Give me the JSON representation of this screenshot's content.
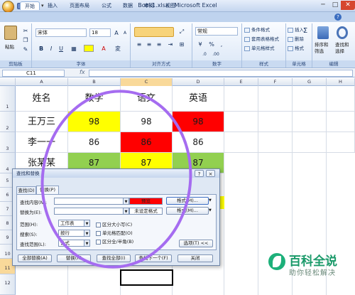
{
  "window": {
    "title": "Book1.xlsx - Microsoft Excel"
  },
  "tabs": [
    "开始",
    "插入",
    "页面布局",
    "公式",
    "数据",
    "审阅",
    "视图"
  ],
  "ribbon": {
    "clipboard": {
      "paste": "粘贴",
      "label": "剪贴板"
    },
    "font": {
      "name": "宋体",
      "size": "18",
      "bold": "B",
      "italic": "I",
      "underline": "U",
      "label": "字体"
    },
    "alignment": {
      "label": "对齐方式"
    },
    "number": {
      "format": "常规",
      "percent": "%",
      "comma": ",",
      "label": "数字"
    },
    "styles": {
      "items": [
        "条件格式",
        "套用表格格式",
        "单元格样式"
      ],
      "label": "样式"
    },
    "cells": {
      "items": [
        "插入",
        "删除",
        "格式"
      ],
      "label": "单元格"
    },
    "editing": {
      "sort": "排序和",
      "sort2": "筛选",
      "find": "查找和",
      "find2": "选择",
      "label": "编辑"
    }
  },
  "formula_bar": {
    "name_box": "C11",
    "fx": "fx",
    "value": ""
  },
  "grid": {
    "columns": [
      "A",
      "B",
      "C",
      "D",
      "E",
      "F",
      "G",
      "H"
    ],
    "rows": [
      "1",
      "2",
      "3",
      "4",
      "5",
      "6",
      "7",
      "8",
      "9",
      "10",
      "11",
      "12"
    ],
    "header_row": [
      "姓名",
      "数学",
      "语文",
      "英语"
    ],
    "data": [
      [
        "王万三",
        "98",
        "98",
        "98"
      ],
      [
        "李一一",
        "86",
        "86",
        "86"
      ],
      [
        "张某某",
        "87",
        "87",
        "87"
      ]
    ],
    "colors": {
      "yellow": "#ffff00",
      "red": "#ff0000",
      "green": "#92d050"
    }
  },
  "dialog": {
    "title": "查找和替换",
    "help": "?",
    "close": "×",
    "tabs": [
      "查找(D)",
      "替换(P)"
    ],
    "find_label": "查找内容(N):",
    "replace_label": "替换为(E):",
    "find_format_preview": "预览",
    "no_format_preview": "未设定格式",
    "format_btn": "格式(M)...",
    "format_btn2": "格式(M)...",
    "scope_label": "范围(H):",
    "scope_value": "工作表",
    "search_label": "搜索(S):",
    "search_value": "按行",
    "lookin_label": "查找范围(L):",
    "lookin_value": "公式",
    "match_case": "区分大小写(C)",
    "match_cell": "单元格匹配(O)",
    "match_width": "区分全/半角(B)",
    "options": "选项(T) <<",
    "replace_all": "全部替换(A)",
    "replace": "替换(R)",
    "find_all": "查找全部(I)",
    "find_next": "查找下一个(F)",
    "close_btn": "关闭"
  },
  "watermark": {
    "title": "百科全说",
    "subtitle": "助你轻松解决"
  }
}
